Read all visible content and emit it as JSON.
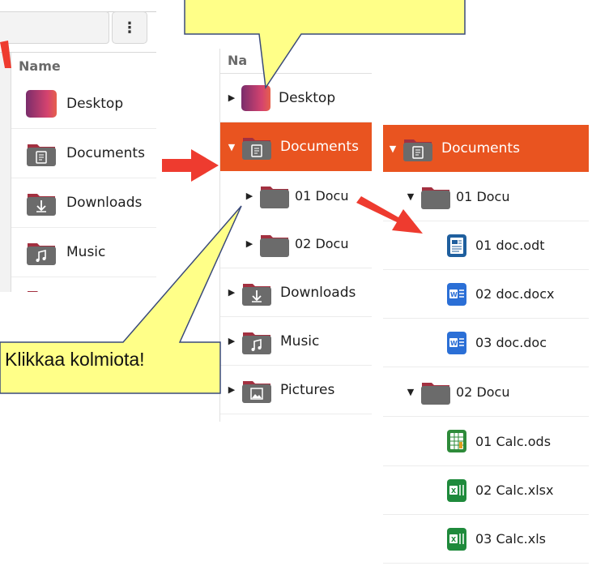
{
  "left_panel": {
    "menu_glyph": "⋮",
    "column_header": "Name",
    "items": [
      "Desktop",
      "Documents",
      "Downloads",
      "Music"
    ]
  },
  "middle_panel": {
    "column_header_partial": "Na",
    "items": {
      "desktop": "Desktop",
      "documents": "Documents",
      "sub1": "01 Docu",
      "sub2": "02 Docu",
      "downloads": "Downloads",
      "music": "Music",
      "pictures": "Pictures"
    }
  },
  "right_panel": {
    "documents": "Documents",
    "folder1": "01 Docu",
    "files1": [
      "01 doc.odt",
      "02 doc.docx",
      "03 doc.doc"
    ],
    "folder2": "02 Docu",
    "files2": [
      "01 Calc.ods",
      "02 Calc.xlsx",
      "03 Calc.xls"
    ]
  },
  "callout": {
    "text": "Klikkaa kolmiota!"
  },
  "colors": {
    "accent": "#e95420",
    "callout_fill": "#ffff88",
    "arrow": "#ee3b2f",
    "folder_body": "#6b6b6b",
    "folder_tab": "#a33040"
  },
  "icons": {
    "desktop": "desktop-folder-icon",
    "documents": "documents-folder-icon",
    "downloads": "downloads-folder-icon",
    "music": "music-folder-icon",
    "pictures": "pictures-folder-icon",
    "odt": "writer-document-icon",
    "docx": "word-document-icon",
    "ods": "calc-spreadsheet-icon",
    "xlsx": "excel-spreadsheet-icon"
  }
}
